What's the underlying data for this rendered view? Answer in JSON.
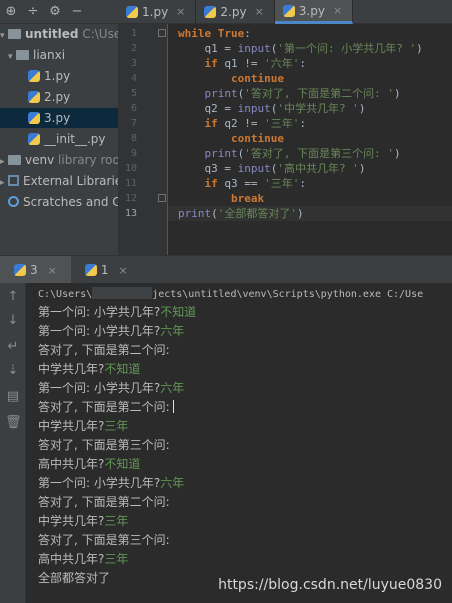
{
  "project": {
    "toolbar_icons": [
      "globe-icon",
      "divide-icon",
      "gear-icon",
      "minus-icon"
    ],
    "root_label": "untitled",
    "root_path": "C:\\Users\\",
    "folder": "lianxi",
    "files": [
      "1.py",
      "2.py",
      "3.py",
      "__init__.py"
    ],
    "selected_file": "3.py",
    "venv_label": "venv",
    "venv_note": "library roo",
    "external_libraries": "External Libraries",
    "scratches": "Scratches and Cons"
  },
  "editor": {
    "tabs": [
      {
        "label": "1.py",
        "close": "×"
      },
      {
        "label": "2.py",
        "close": "×"
      },
      {
        "label": "3.py",
        "close": "×"
      }
    ],
    "active_tab": "3.py",
    "line_numbers": [
      "1",
      "2",
      "3",
      "4",
      "5",
      "6",
      "7",
      "8",
      "9",
      "10",
      "11",
      "12",
      "13"
    ],
    "current_line": "13",
    "code": {
      "l1_kw": "while",
      "l1_val": "True",
      "l1_colon": ":",
      "l2_var": "q1",
      "l2_eq": " = ",
      "l2_fn": "input",
      "l2_str": "'第一个问: 小学共几年? '",
      "l3_kw": "if",
      "l3_var": "q1",
      "l3_op": " != ",
      "l3_str": "'六年'",
      "l3_colon": ":",
      "l4_kw": "continue",
      "l5_fn": "print",
      "l5_str": "'答对了, 下面是第二个问: '",
      "l6_var": "q2",
      "l6_eq": " = ",
      "l6_fn": "input",
      "l6_str": "'中学共几年? '",
      "l7_kw": "if",
      "l7_var": "q2",
      "l7_op": " != ",
      "l7_str": "'三年'",
      "l7_colon": ":",
      "l8_kw": "continue",
      "l9_fn": "print",
      "l9_str": "'答对了, 下面是第三个问: '",
      "l10_var": "q3",
      "l10_eq": " = ",
      "l10_fn": "input",
      "l10_str": "'高中共几年? '",
      "l11_kw": "if",
      "l11_var": "q3",
      "l11_op": " == ",
      "l11_str": "'三年'",
      "l11_colon": ":",
      "l12_kw": "break",
      "l13_fn": "print",
      "l13_str": "'全部都答对了'"
    }
  },
  "run": {
    "tabs": [
      {
        "label": "3",
        "close": "×"
      },
      {
        "label": "1",
        "close": "×"
      }
    ],
    "side_icons": [
      "up-arrow-icon",
      "down-arrow-icon",
      "wrap-icon",
      "sort-icon",
      "print-icon",
      "trash-icon"
    ],
    "command_start": "C:\\Users\\",
    "command_end": "jects\\untitled\\venv\\Scripts\\python.exe C:/Use",
    "lines": [
      {
        "prompt": "第一个问: 小学共几年?",
        "answer": "不知道"
      },
      {
        "prompt": "第一个问: 小学共几年?",
        "answer": "六年"
      },
      {
        "prompt": "答对了, 下面是第二个问:",
        "answer": ""
      },
      {
        "prompt": "中学共几年?",
        "answer": "不知道"
      },
      {
        "prompt": "第一个问: 小学共几年?",
        "answer": "六年"
      },
      {
        "prompt": "答对了, 下面是第二个问:",
        "answer": ""
      },
      {
        "prompt": "中学共几年?",
        "answer": "三年"
      },
      {
        "prompt": "答对了, 下面是第三个问:",
        "answer": ""
      },
      {
        "prompt": "高中共几年?",
        "answer": "不知道"
      },
      {
        "prompt": "第一个问: 小学共几年?",
        "answer": "六年"
      },
      {
        "prompt": "答对了, 下面是第二个问:",
        "answer": ""
      },
      {
        "prompt": "中学共几年?",
        "answer": "三年"
      },
      {
        "prompt": "答对了, 下面是第三个问:",
        "answer": ""
      },
      {
        "prompt": "高中共几年?",
        "answer": "三年"
      },
      {
        "prompt": "全部都答对了",
        "answer": ""
      }
    ],
    "watermark": "https://blog.csdn.net/luyue0830"
  }
}
